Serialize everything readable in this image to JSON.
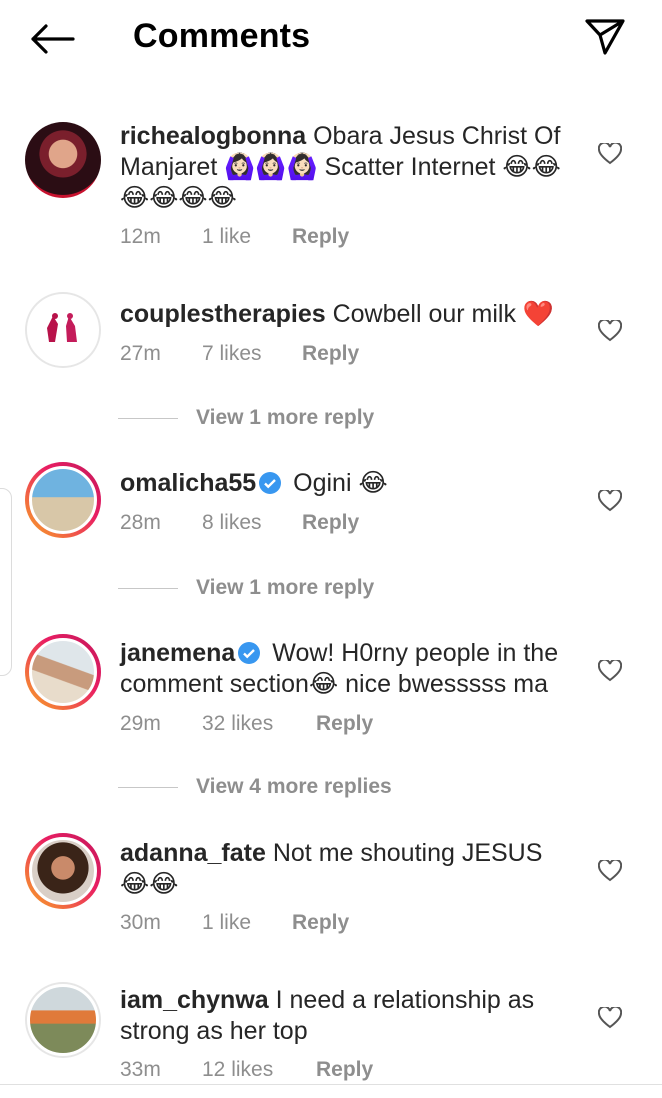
{
  "header": {
    "title": "Comments",
    "back_icon": "arrow-left-icon",
    "send_icon": "paper-plane-icon"
  },
  "comments": [
    {
      "username": "richealogbonna",
      "text": "Obara Jesus Christ Of Manjaret 🙆🏻‍♀️🙆🏻‍♀️🙆🏻‍♀️ Scatter Internet 😂😂😂😂😂😂",
      "time": "12m",
      "likes": "1 like",
      "reply": "Reply",
      "verified": false,
      "avatar_ring": "none"
    },
    {
      "username": "couplestherapies",
      "text": "Cowbell our milk ❤️",
      "time": "27m",
      "likes": "7 likes",
      "reply": "Reply",
      "verified": false,
      "avatar_ring": "grey",
      "view_more": "View 1 more reply"
    },
    {
      "username": "omalicha55",
      "text": "Ogini 😂",
      "time": "28m",
      "likes": "8 likes",
      "reply": "Reply",
      "verified": true,
      "avatar_ring": "story",
      "view_more": "View 1 more reply"
    },
    {
      "username": "janemena",
      "text": "Wow! H0rny people in the comment section😂 nice bwesssss ma",
      "time": "29m",
      "likes": "32 likes",
      "reply": "Reply",
      "verified": true,
      "avatar_ring": "story",
      "view_more": "View 4 more replies"
    },
    {
      "username": "adanna_fate",
      "text": "Not me shouting JESUS 😂😂",
      "time": "30m",
      "likes": "1 like",
      "reply": "Reply",
      "verified": false,
      "avatar_ring": "story"
    },
    {
      "username": "iam_chynwa",
      "text": "I need a relationship as strong as her top",
      "time": "33m",
      "likes": "12 likes",
      "reply": "Reply",
      "verified": false,
      "avatar_ring": "grey"
    }
  ],
  "colors": {
    "text": "#262626",
    "meta": "#8e8e8e",
    "verified": "#3897f0",
    "heart_emoji": "#e0245e",
    "story_ring_start": "#f9a825",
    "story_ring_end": "#c2185b"
  }
}
